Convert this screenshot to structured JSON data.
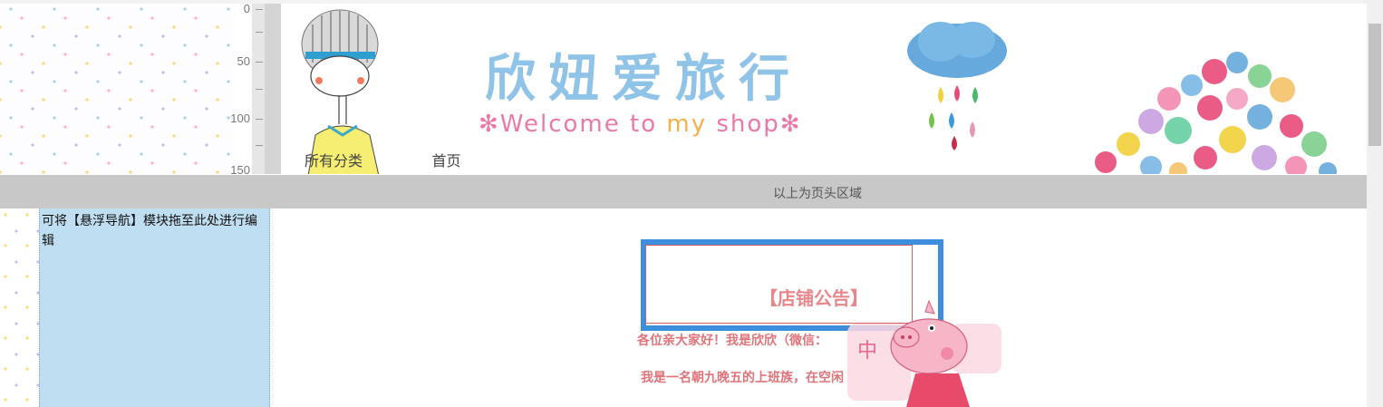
{
  "ruler": {
    "marks": [
      "0",
      "50",
      "100",
      "150"
    ]
  },
  "banner": {
    "title": "欣妞爱旅行",
    "subtitle": {
      "star_left": "✻",
      "word1": "Welcome",
      "word2": "to",
      "word3": "my",
      "word4": "shop",
      "star_right": "✻"
    }
  },
  "nav": {
    "items": [
      "所有分类",
      "首页"
    ]
  },
  "header_divider": {
    "label": "以上为页头区域"
  },
  "float_nav": {
    "text": "可将【悬浮导航】模块拖至此处进行编辑"
  },
  "notice": {
    "title": "【店铺公告】",
    "line1": "各位亲大家好！我是欣欣（微信：",
    "line2": "我是一名朝九晚五的上班族，在空闲"
  },
  "colors": {
    "title_blue": "#8fc3e8",
    "subtitle_pink": "#ec78a8",
    "notice_red": "#e0747a",
    "selection_blue": "#3d8fdd",
    "float_nav_bg": "#c0def1",
    "divider_gray": "#c8c8c8"
  },
  "icons": [
    "girl-illustration",
    "rain-cloud-illustration",
    "colorful-dots-tree",
    "peppa-pig-sticker"
  ]
}
